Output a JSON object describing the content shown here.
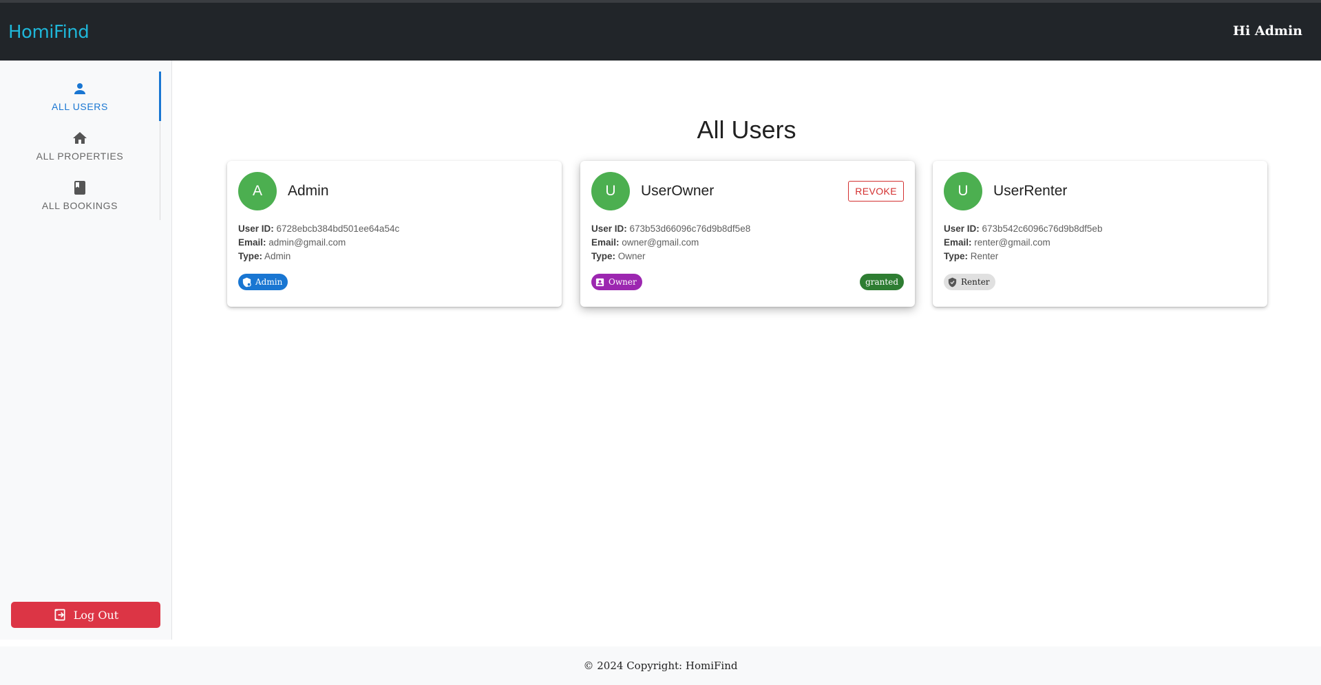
{
  "header": {
    "brand": "HomiFind",
    "greeting": "Hi Admin"
  },
  "sidebar": {
    "tabs": [
      {
        "label": "ALL USERS",
        "icon": "person-icon",
        "active": true
      },
      {
        "label": "ALL PROPERTIES",
        "icon": "home-icon",
        "active": false
      },
      {
        "label": "ALL BOOKINGS",
        "icon": "book-icon",
        "active": false
      }
    ],
    "logout_label": "Log Out"
  },
  "main": {
    "title": "All Users",
    "field_labels": {
      "user_id": "User ID:",
      "email": "Email:",
      "type": "Type:"
    },
    "users": [
      {
        "initial": "A",
        "name": "Admin",
        "user_id": "6728ebcb384bd501ee64a54c",
        "email": "admin@gmail.com",
        "type": "Admin",
        "badge": {
          "label": "Admin",
          "icon": "admin-shield-icon",
          "color": "#1976d2"
        }
      },
      {
        "initial": "U",
        "name": "UserOwner",
        "user_id": "673b53d66096c76d9b8df5e8",
        "email": "owner@gmail.com",
        "type": "Owner",
        "action_label": "REVOKE",
        "badge": {
          "label": "Owner",
          "icon": "contact-card-icon",
          "color": "#9c27b0"
        },
        "status": {
          "label": "granted",
          "color": "#2e7d32"
        }
      },
      {
        "initial": "U",
        "name": "UserRenter",
        "user_id": "673b542c6096c76d9b8df5eb",
        "email": "renter@gmail.com",
        "type": "Renter",
        "badge": {
          "label": "Renter",
          "icon": "verified-shield-icon",
          "color": "#e0e0e0"
        }
      }
    ]
  },
  "footer": {
    "text": "© 2024 Copyright: HomiFind"
  },
  "colors": {
    "header_bg": "#212529",
    "brand": "#1fb6d8",
    "accent": "#1976d2",
    "avatar": "#4caf50",
    "danger": "#dc3545"
  }
}
